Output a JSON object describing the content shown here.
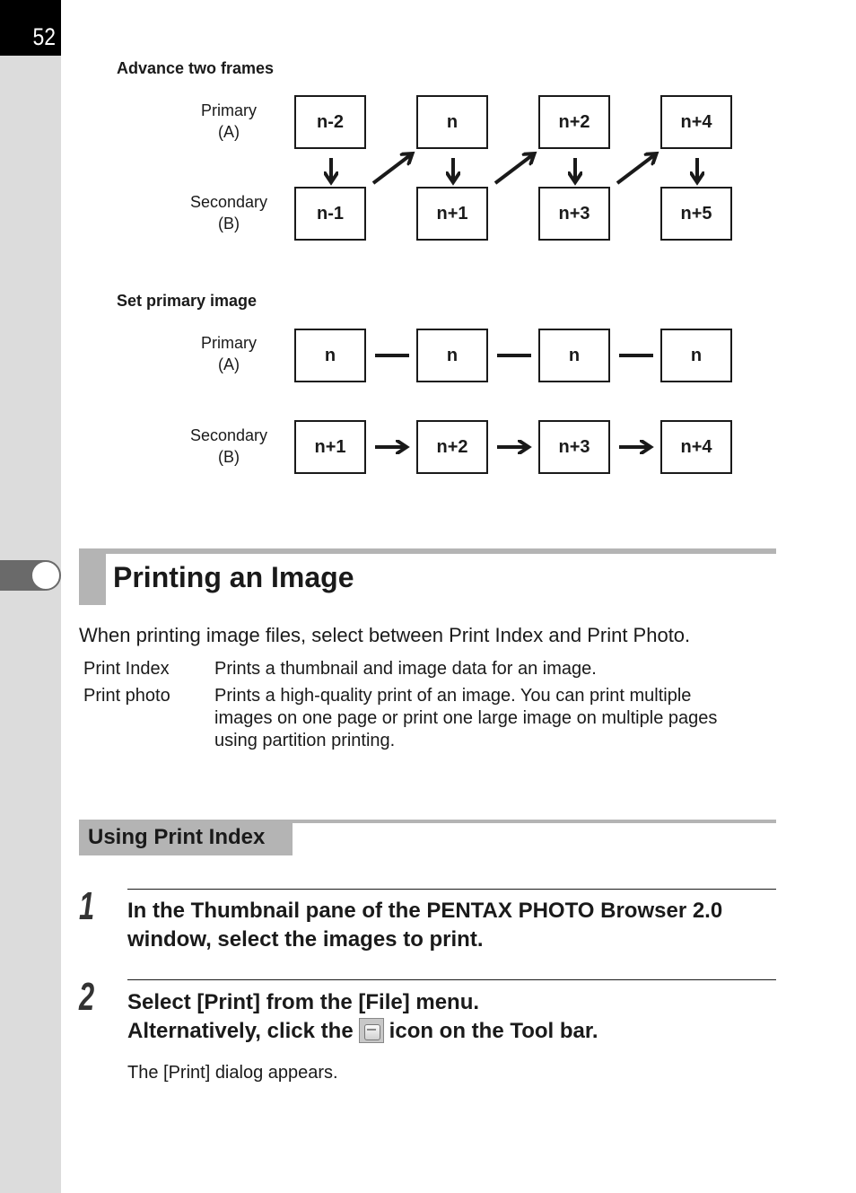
{
  "page": {
    "number": "52"
  },
  "diagrams": [
    {
      "title": "Advance two frames",
      "rows": [
        {
          "label_line1": "Primary",
          "label_line2": "(A)",
          "frames": [
            "n-2",
            "n",
            "n+2",
            "n+4"
          ]
        },
        {
          "label_line1": "Secondary",
          "label_line2": "(B)",
          "frames": [
            "n-1",
            "n+1",
            "n+3",
            "n+5"
          ]
        }
      ],
      "connectors": "down arrows from each primary to secondary; diagonal up arrows from each secondary to next primary"
    },
    {
      "title": "Set primary image",
      "rows": [
        {
          "label_line1": "Primary",
          "label_line2": "(A)",
          "frames": [
            "n",
            "n",
            "n",
            "n"
          ]
        },
        {
          "label_line1": "Secondary",
          "label_line2": "(B)",
          "frames": [
            "n+1",
            "n+2",
            "n+3",
            "n+4"
          ]
        }
      ],
      "connectors": "lines between primary frames; right arrows between secondary frames"
    }
  ],
  "section": {
    "title": "Printing an Image",
    "intro": "When printing image files, select between Print Index and Print Photo.",
    "definitions": [
      {
        "term": "Print Index",
        "desc": "Prints a thumbnail and image data for an image."
      },
      {
        "term": "Print photo",
        "desc_lines": [
          "Prints a high-quality print of an image. You can print multiple",
          "images on one page or print one large image on multiple pages",
          "using partition printing."
        ]
      }
    ]
  },
  "subsection": {
    "title": "Using Print Index",
    "steps": [
      {
        "num": "1",
        "lines": [
          "In the Thumbnail pane of the PENTAX PHOTO Browser 2.0",
          "window, select the images to print."
        ]
      },
      {
        "num": "2",
        "line1": "Select [Print] from the [File] menu.",
        "line2_before": "Alternatively, click the",
        "line2_after": "icon on the Tool bar.",
        "icon": "printer-icon",
        "note": "The [Print] dialog appears."
      }
    ]
  }
}
